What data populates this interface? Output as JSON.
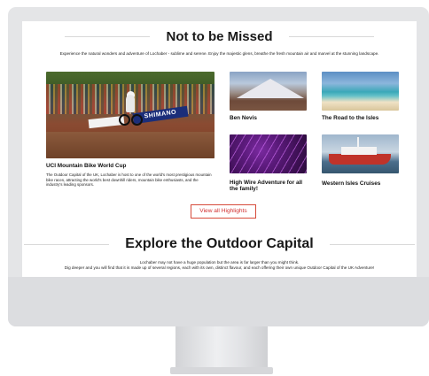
{
  "section1": {
    "title": "Not to be Missed",
    "intro": "Experience the natural wonders and adventure of Lochaber - sublime and serene. Enjoy the majestic glens, breathe the fresh mountain air and marvel at the stunning landscape."
  },
  "featured": {
    "title": "UCI Mountain Bike World Cup",
    "description": "The Outdoor Capital of the UK, Lochaber is host to one of the world's most prestigious mountain bike races, attracting the world's best downhill riders, mountain bike enthusiasts, and the industry's leading sponsors.",
    "banner_text": "SHIMANO"
  },
  "highlights": [
    {
      "title": "Ben Nevis"
    },
    {
      "title": "The Road to the Isles"
    },
    {
      "title": "High Wire Adventure for all the family!"
    },
    {
      "title": "Western Isles Cruises"
    }
  ],
  "cta_label": "View all Highlights",
  "section2": {
    "title": "Explore the Outdoor Capital",
    "intro_line1": "Lochaber may not have a huge population but the area is far larger than you might think.",
    "intro_line2": "Dig deeper and you will find that it is made up of several regions, each with its own, distinct flavour, and each offering their own unique Outdoor Capital of the UK Adventure!"
  },
  "colors": {
    "accent": "#d12f2f",
    "monitor_frame": "#e4e5e7",
    "heading": "#1a1a1a"
  }
}
